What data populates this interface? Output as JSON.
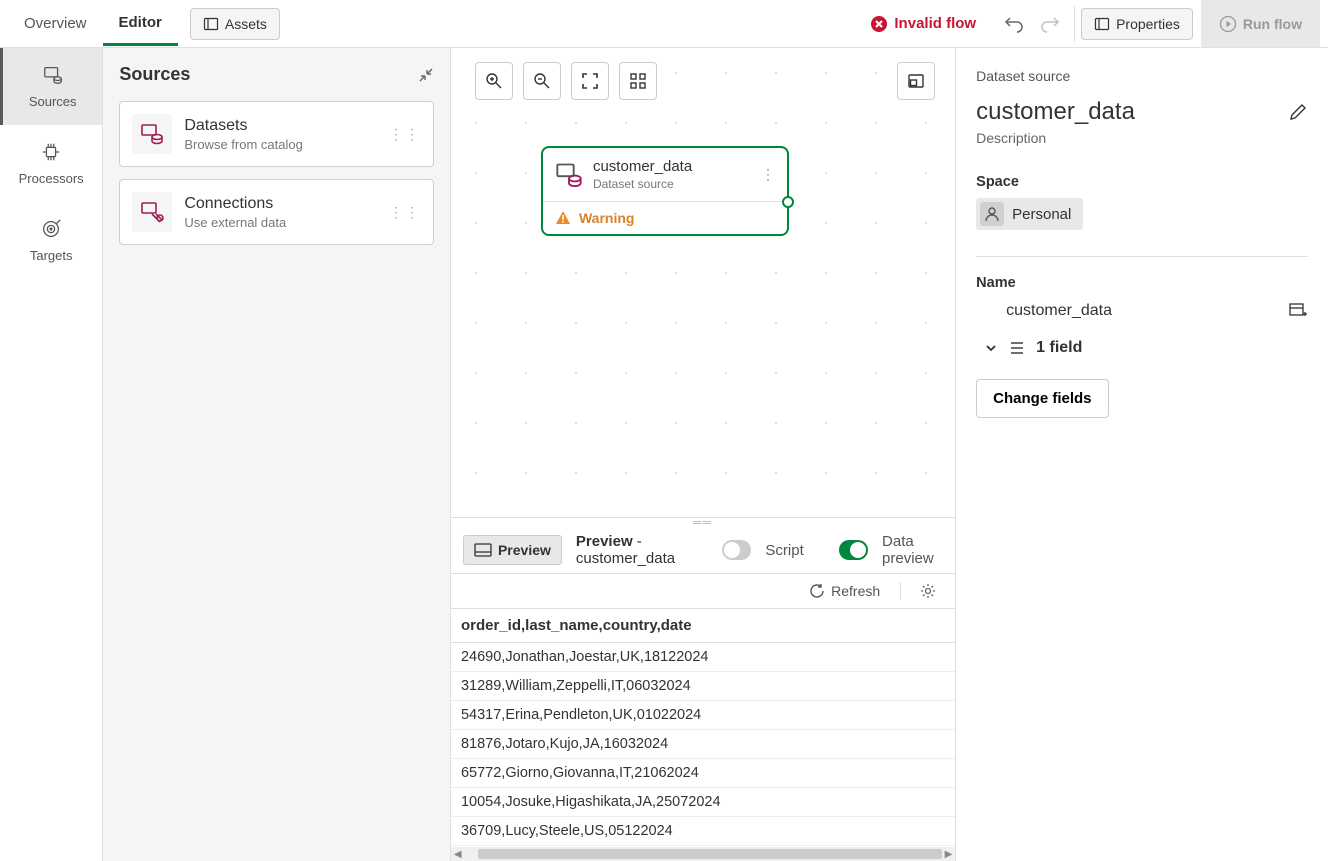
{
  "tabs": {
    "overview": "Overview",
    "editor": "Editor",
    "assets": "Assets"
  },
  "header": {
    "invalid_flow": "Invalid flow",
    "properties": "Properties",
    "run_flow": "Run flow"
  },
  "rail": {
    "sources": "Sources",
    "processors": "Processors",
    "targets": "Targets"
  },
  "sources_panel": {
    "title": "Sources",
    "cards": [
      {
        "title": "Datasets",
        "sub": "Browse from catalog"
      },
      {
        "title": "Connections",
        "sub": "Use external data"
      }
    ]
  },
  "canvas": {
    "node": {
      "title": "customer_data",
      "subtitle": "Dataset source",
      "warning": "Warning"
    }
  },
  "preview": {
    "chip": "Preview",
    "title_prefix": "Preview",
    "title_suffix": " - customer_data",
    "script": "Script",
    "data_preview": "Data preview",
    "refresh": "Refresh",
    "header_row": "order_id,last_name,country,date",
    "rows": [
      "24690,Jonathan,Joestar,UK,18122024",
      "31289,William,Zeppelli,IT,06032024",
      "54317,Erina,Pendleton,UK,01022024",
      "81876,Jotaro,Kujo,JA,16032024",
      "65772,Giorno,Giovanna,IT,21062024",
      "10054,Josuke,Higashikata,JA,25072024",
      "36709,Lucy,Steele,US,05122024"
    ]
  },
  "props": {
    "type_label": "Dataset source",
    "title": "customer_data",
    "desc": "Description",
    "space_label": "Space",
    "space_value": "Personal",
    "name_label": "Name",
    "name_value": "customer_data",
    "field_count": "1 field",
    "change_fields": "Change fields"
  }
}
